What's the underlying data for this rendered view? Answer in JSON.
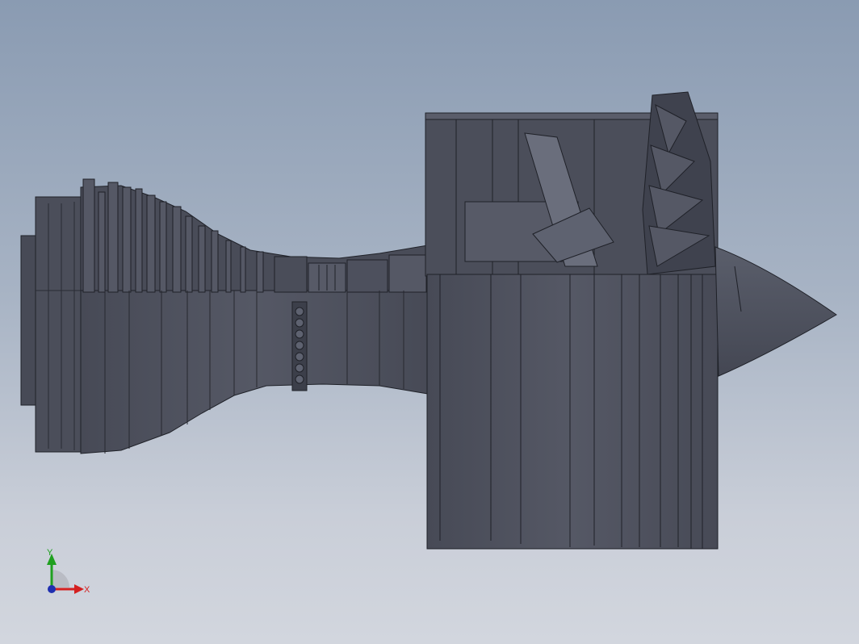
{
  "viewport": {
    "background_top": "#8a9bb2",
    "background_bottom": "#d2d6de"
  },
  "model": {
    "body_color": "#4d505d",
    "dark_color": "#3f424e",
    "edge_color": "#1f2128",
    "highlight_color": "#6a6e7c"
  },
  "triad": {
    "x_label": "X",
    "y_label": "Y",
    "x_color": "#d42020",
    "y_color": "#1fa01f",
    "z_color": "#1f2fb0"
  }
}
